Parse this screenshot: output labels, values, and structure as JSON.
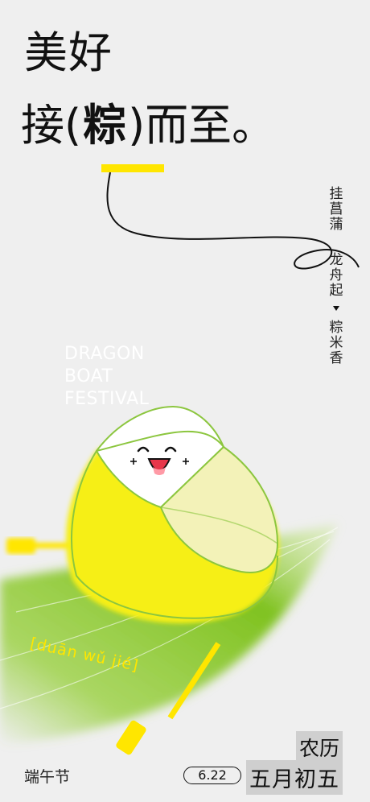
{
  "headline": {
    "line1": "美好",
    "line2_prefix": "接(",
    "line2_highlight": "粽",
    "line2_suffix": ")而至。"
  },
  "vertical_text": {
    "col1": "挂菖蒲",
    "col2": "龙舟起",
    "col3": "粽米香"
  },
  "english_title": "DRAGON\nBOAT\nFESTIVAL",
  "pinyin": "[duān wǔ jié]",
  "festival_name": "端午节",
  "date": "6.22",
  "lunar_line1": "农历",
  "lunar_line2": "五月初五",
  "colors": {
    "background": "#efefef",
    "accent_yellow": "#ffe600",
    "leaf_green": "#8cc63f",
    "text": "#111111"
  }
}
